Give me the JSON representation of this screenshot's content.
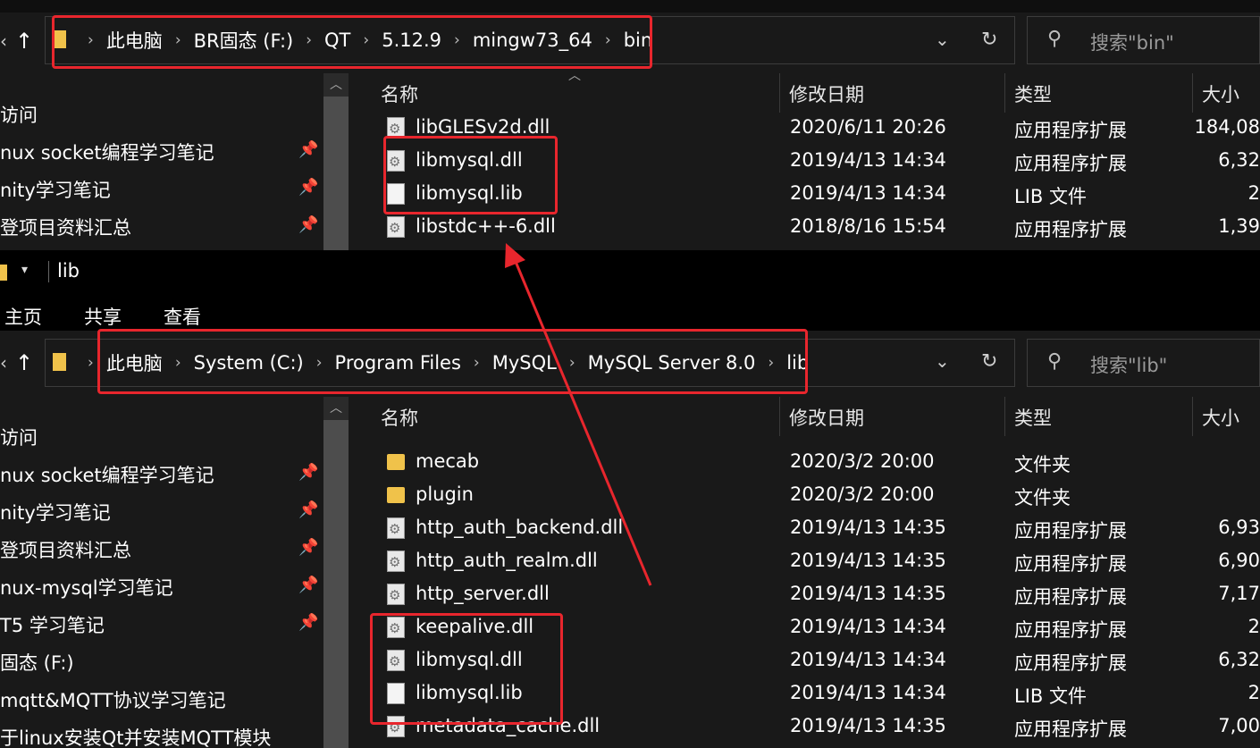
{
  "top_window": {
    "breadcrumb": [
      "此电脑",
      "BR固态 (F:)",
      "QT",
      "5.12.9",
      "mingw73_64",
      "bin"
    ],
    "search_placeholder": "搜索\"bin\"",
    "columns": {
      "name": "名称",
      "date": "修改日期",
      "type": "类型",
      "size": "大小"
    },
    "nav_items": [
      {
        "label": "访问",
        "pinned": false
      },
      {
        "label": "nux socket编程学习笔记",
        "pinned": true
      },
      {
        "label": "nity学习笔记",
        "pinned": true
      },
      {
        "label": "登项目资料汇总",
        "pinned": true
      }
    ],
    "files": [
      {
        "name": "libGLESv2d.dll",
        "date": "2020/6/11 20:26",
        "type": "应用程序扩展",
        "size": "184,08",
        "icon": "dll-file-icon"
      },
      {
        "name": "libmysql.dll",
        "date": "2019/4/13 14:34",
        "type": "应用程序扩展",
        "size": "6,32",
        "icon": "dll-file-icon"
      },
      {
        "name": "libmysql.lib",
        "date": "2019/4/13 14:34",
        "type": "LIB 文件",
        "size": "2",
        "icon": "file-icon"
      },
      {
        "name": "libstdc++-6.dll",
        "date": "2018/8/16 15:54",
        "type": "应用程序扩展",
        "size": "1,39",
        "icon": "dll-file-icon"
      }
    ]
  },
  "bottom_window": {
    "title": "lib",
    "ribbon_tabs": [
      "主页",
      "共享",
      "查看"
    ],
    "breadcrumb": [
      "此电脑",
      "System (C:)",
      "Program Files",
      "MySQL",
      "MySQL Server 8.0",
      "lib"
    ],
    "search_placeholder": "搜索\"lib\"",
    "columns": {
      "name": "名称",
      "date": "修改日期",
      "type": "类型",
      "size": "大小"
    },
    "nav_items": [
      {
        "label": "访问",
        "pinned": false
      },
      {
        "label": "nux socket编程学习笔记",
        "pinned": true
      },
      {
        "label": "nity学习笔记",
        "pinned": true
      },
      {
        "label": "登项目资料汇总",
        "pinned": true
      },
      {
        "label": "nux-mysql学习笔记",
        "pinned": true
      },
      {
        "label": "T5 学习笔记",
        "pinned": true
      },
      {
        "label": "固态 (F:)",
        "pinned": false
      },
      {
        "label": "mqtt&MQTT协议学习笔记",
        "pinned": false
      },
      {
        "label": "于linux安装Qt并安装MQTT模块",
        "pinned": false
      }
    ],
    "files": [
      {
        "name": "mecab",
        "date": "2020/3/2 20:00",
        "type": "文件夹",
        "size": "",
        "icon": "folder-icon"
      },
      {
        "name": "plugin",
        "date": "2020/3/2 20:00",
        "type": "文件夹",
        "size": "",
        "icon": "folder-icon"
      },
      {
        "name": "http_auth_backend.dll",
        "date": "2019/4/13 14:35",
        "type": "应用程序扩展",
        "size": "6,93",
        "icon": "dll-file-icon"
      },
      {
        "name": "http_auth_realm.dll",
        "date": "2019/4/13 14:35",
        "type": "应用程序扩展",
        "size": "6,90",
        "icon": "dll-file-icon"
      },
      {
        "name": "http_server.dll",
        "date": "2019/4/13 14:35",
        "type": "应用程序扩展",
        "size": "7,17",
        "icon": "dll-file-icon"
      },
      {
        "name": "keepalive.dll",
        "date": "2019/4/13 14:34",
        "type": "应用程序扩展",
        "size": "2",
        "icon": "dll-file-icon"
      },
      {
        "name": "libmysql.dll",
        "date": "2019/4/13 14:34",
        "type": "应用程序扩展",
        "size": "6,32",
        "icon": "dll-file-icon"
      },
      {
        "name": "libmysql.lib",
        "date": "2019/4/13 14:34",
        "type": "LIB 文件",
        "size": "2",
        "icon": "file-icon"
      },
      {
        "name": "metadata_cache.dll",
        "date": "2019/4/13 14:35",
        "type": "应用程序扩展",
        "size": "7,00",
        "icon": "dll-file-icon"
      }
    ]
  },
  "colors": {
    "annotation_red": "#e8262d",
    "background": "#191919",
    "folder_yellow": "#f0c24a"
  }
}
